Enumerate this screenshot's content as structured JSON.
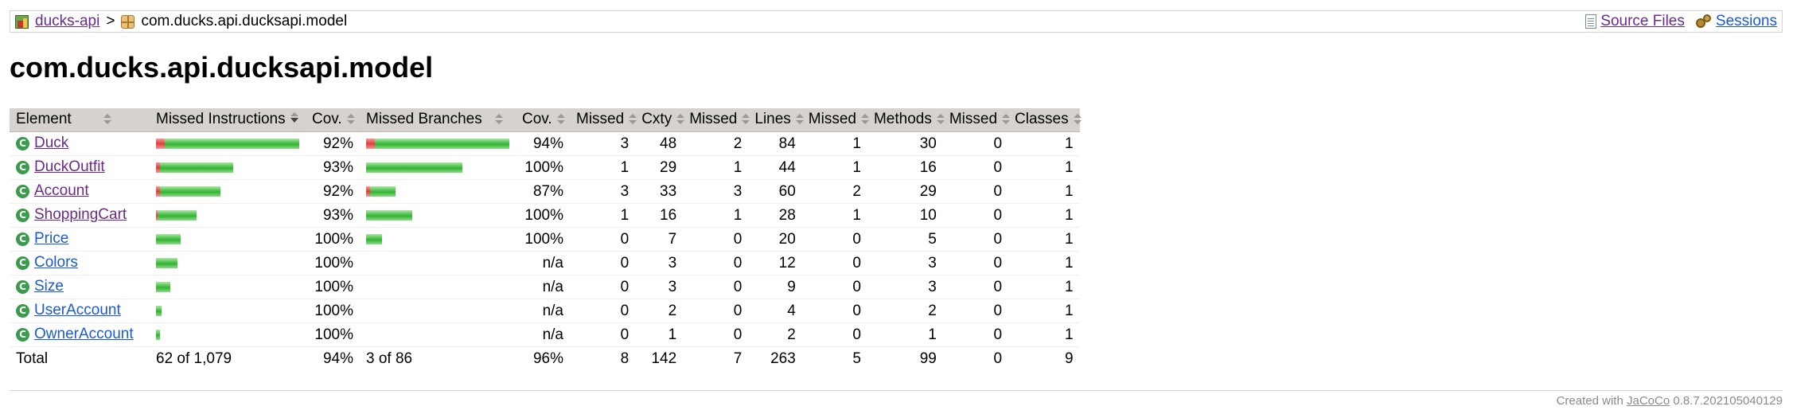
{
  "breadcrumb": {
    "report_link": "ducks-api",
    "separator": ">",
    "package": "com.ducks.api.ducksapi.model",
    "source_files": "Source Files",
    "sessions": "Sessions"
  },
  "page_title": "com.ducks.api.ducksapi.model",
  "table": {
    "headers": {
      "element": "Element",
      "missed_instructions": "Missed Instructions",
      "cov1": "Cov.",
      "missed_branches": "Missed Branches",
      "cov2": "Cov.",
      "missed_cxty": "Missed",
      "cxty": "Cxty",
      "missed_lines": "Missed",
      "lines": "Lines",
      "missed_methods": "Missed",
      "methods": "Methods",
      "missed_classes": "Missed",
      "classes": "Classes"
    },
    "rows": [
      {
        "name": "Duck",
        "visited": true,
        "instr_missed": 0.06,
        "instr_covered": 0.94,
        "instr_cov": "92%",
        "br_missed": 0.06,
        "br_covered": 0.94,
        "br_cov": "94%",
        "has_br": true,
        "missed_cxty": "3",
        "cxty": "48",
        "missed_lines": "2",
        "lines": "84",
        "missed_methods": "1",
        "methods": "30",
        "missed_classes": "0",
        "classes": "1"
      },
      {
        "name": "DuckOutfit",
        "visited": true,
        "instr_missed": 0.03,
        "instr_covered": 0.51,
        "instr_cov": "93%",
        "br_missed": 0.0,
        "br_covered": 0.67,
        "br_cov": "100%",
        "has_br": true,
        "missed_cxty": "1",
        "cxty": "29",
        "missed_lines": "1",
        "lines": "44",
        "missed_methods": "1",
        "methods": "16",
        "missed_classes": "0",
        "classes": "1"
      },
      {
        "name": "Account",
        "visited": true,
        "instr_missed": 0.03,
        "instr_covered": 0.42,
        "instr_cov": "92%",
        "br_missed": 0.03,
        "br_covered": 0.18,
        "br_cov": "87%",
        "has_br": true,
        "missed_cxty": "3",
        "cxty": "33",
        "missed_lines": "3",
        "lines": "60",
        "missed_methods": "2",
        "methods": "29",
        "missed_classes": "0",
        "classes": "1"
      },
      {
        "name": "ShoppingCart",
        "visited": true,
        "instr_missed": 0.01,
        "instr_covered": 0.27,
        "instr_cov": "93%",
        "br_missed": 0.0,
        "br_covered": 0.32,
        "br_cov": "100%",
        "has_br": true,
        "missed_cxty": "1",
        "cxty": "16",
        "missed_lines": "1",
        "lines": "28",
        "missed_methods": "1",
        "methods": "10",
        "missed_classes": "0",
        "classes": "1"
      },
      {
        "name": "Price",
        "visited": false,
        "instr_missed": 0.0,
        "instr_covered": 0.17,
        "instr_cov": "100%",
        "br_missed": 0.0,
        "br_covered": 0.11,
        "br_cov": "100%",
        "has_br": true,
        "missed_cxty": "0",
        "cxty": "7",
        "missed_lines": "0",
        "lines": "20",
        "missed_methods": "0",
        "methods": "5",
        "missed_classes": "0",
        "classes": "1"
      },
      {
        "name": "Colors",
        "visited": false,
        "instr_missed": 0.0,
        "instr_covered": 0.15,
        "instr_cov": "100%",
        "br_missed": 0.0,
        "br_covered": 0.0,
        "br_cov": "n/a",
        "has_br": false,
        "missed_cxty": "0",
        "cxty": "3",
        "missed_lines": "0",
        "lines": "12",
        "missed_methods": "0",
        "methods": "3",
        "missed_classes": "0",
        "classes": "1"
      },
      {
        "name": "Size",
        "visited": false,
        "instr_missed": 0.0,
        "instr_covered": 0.1,
        "instr_cov": "100%",
        "br_missed": 0.0,
        "br_covered": 0.0,
        "br_cov": "n/a",
        "has_br": false,
        "missed_cxty": "0",
        "cxty": "3",
        "missed_lines": "0",
        "lines": "9",
        "missed_methods": "0",
        "methods": "3",
        "missed_classes": "0",
        "classes": "1"
      },
      {
        "name": "UserAccount",
        "visited": false,
        "instr_missed": 0.0,
        "instr_covered": 0.04,
        "instr_cov": "100%",
        "br_missed": 0.0,
        "br_covered": 0.0,
        "br_cov": "n/a",
        "has_br": false,
        "missed_cxty": "0",
        "cxty": "2",
        "missed_lines": "0",
        "lines": "4",
        "missed_methods": "0",
        "methods": "2",
        "missed_classes": "0",
        "classes": "1"
      },
      {
        "name": "OwnerAccount",
        "visited": false,
        "instr_missed": 0.0,
        "instr_covered": 0.03,
        "instr_cov": "100%",
        "br_missed": 0.0,
        "br_covered": 0.0,
        "br_cov": "n/a",
        "has_br": false,
        "missed_cxty": "0",
        "cxty": "1",
        "missed_lines": "0",
        "lines": "2",
        "missed_methods": "0",
        "methods": "1",
        "missed_classes": "0",
        "classes": "1"
      }
    ],
    "total": {
      "label": "Total",
      "instructions": "62 of 1,079",
      "instr_cov": "94%",
      "branches": "3 of 86",
      "br_cov": "96%",
      "missed_cxty": "8",
      "cxty": "142",
      "missed_lines": "7",
      "lines": "263",
      "missed_methods": "5",
      "methods": "99",
      "missed_classes": "0",
      "classes": "9"
    }
  },
  "footer": {
    "prefix": "Created with",
    "link": "JaCoCo",
    "version": "0.8.7.202105040129"
  },
  "colors": {
    "header_bg": "#d6d3ce",
    "bar_green": "#31b331",
    "bar_red": "#e23b3b",
    "link": "#1a5ad6",
    "visited_link": "#6a2b8a"
  }
}
